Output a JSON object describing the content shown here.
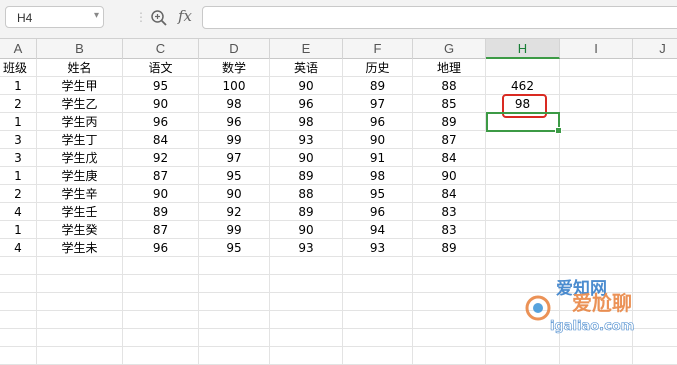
{
  "formula_bar": {
    "namebox_value": "H4",
    "fx_label": "fx",
    "formula_value": ""
  },
  "columns": [
    "A",
    "B",
    "C",
    "D",
    "E",
    "F",
    "G",
    "H",
    "I",
    "J"
  ],
  "active_column": "H",
  "headers": [
    "班级",
    "姓名",
    "语文",
    "数学",
    "英语",
    "历史",
    "地理"
  ],
  "rows": [
    [
      "1",
      "学生甲",
      "95",
      "100",
      "90",
      "89",
      "88"
    ],
    [
      "2",
      "学生乙",
      "90",
      "98",
      "96",
      "97",
      "85"
    ],
    [
      "1",
      "学生丙",
      "96",
      "96",
      "98",
      "96",
      "89"
    ],
    [
      "3",
      "学生丁",
      "84",
      "99",
      "93",
      "90",
      "87"
    ],
    [
      "3",
      "学生戊",
      "92",
      "97",
      "90",
      "91",
      "84"
    ],
    [
      "1",
      "学生庚",
      "87",
      "95",
      "89",
      "98",
      "90"
    ],
    [
      "2",
      "学生辛",
      "90",
      "90",
      "88",
      "95",
      "84"
    ],
    [
      "4",
      "学生壬",
      "89",
      "92",
      "89",
      "96",
      "83"
    ],
    [
      "1",
      "学生癸",
      "87",
      "99",
      "90",
      "94",
      "83"
    ],
    [
      "4",
      "学生未",
      "96",
      "95",
      "93",
      "93",
      "89"
    ]
  ],
  "h_column_values": [
    "462",
    "98"
  ],
  "watermark": {
    "text_top": "爱知网",
    "text_mid": "爱尬聊",
    "url": "igaliao.com"
  },
  "colors": {
    "selection": "#3c9a45",
    "highlight": "#d92a22"
  },
  "icons": {
    "zoom": "zoom-formula-icon",
    "dropdown": "chevron-down-icon"
  }
}
